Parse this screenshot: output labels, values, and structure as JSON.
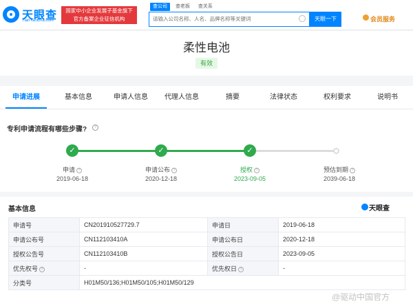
{
  "header": {
    "logo_text": "天眼查",
    "logo_sub": "TianYanCha.com",
    "badge_line1": "国家中小企业发展子基金旗下",
    "badge_line2": "官方备案企业征信机构",
    "search_tabs": [
      "查公司",
      "查老板",
      "查关系"
    ],
    "search_placeholder": "请输入公司名称、人名、品牌名称等关键词",
    "search_button": "天眼一下",
    "member_label": "会员服务",
    "accent_color": "#0084ff"
  },
  "patent": {
    "title": "柔性电池",
    "status": "有效"
  },
  "tabs": [
    {
      "label": "申请进展",
      "active": true
    },
    {
      "label": "基本信息",
      "active": false
    },
    {
      "label": "申请人信息",
      "active": false
    },
    {
      "label": "代理人信息",
      "active": false
    },
    {
      "label": "摘要",
      "active": false
    },
    {
      "label": "法律状态",
      "active": false
    },
    {
      "label": "权利要求",
      "active": false
    },
    {
      "label": "说明书",
      "active": false
    }
  ],
  "flow": {
    "question": "专利申请流程有哪些步骤?",
    "steps": [
      {
        "label": "申请",
        "date": "2019-06-18",
        "done": true,
        "current": false
      },
      {
        "label": "申请公布",
        "date": "2020-12-18",
        "done": true,
        "current": false
      },
      {
        "label": "授权",
        "date": "2023-09-05",
        "done": true,
        "current": true
      },
      {
        "label": "预估到期",
        "date": "2039-06-18",
        "done": false,
        "current": false
      }
    ]
  },
  "basic_info": {
    "title": "基本信息",
    "brand": "天眼查",
    "rows": [
      {
        "k1": "申请号",
        "v1": "CN201910527729.7",
        "k2": "申请日",
        "v2": "2019-06-18"
      },
      {
        "k1": "申请公布号",
        "v1": "CN112103410A",
        "k2": "申请公布日",
        "v2": "2020-12-18"
      },
      {
        "k1": "授权公告号",
        "v1": "CN112103410B",
        "k2": "授权公告日",
        "v2": "2023-09-05"
      },
      {
        "k1": "优先权号",
        "v1": "-",
        "k2": "优先权日",
        "v2": "-"
      },
      {
        "k1": "分类号",
        "v1": "H01M50/136;H01M50/105;H01M50/129",
        "k2": "",
        "v2": ""
      }
    ]
  },
  "watermark": "@驱动中国官方"
}
